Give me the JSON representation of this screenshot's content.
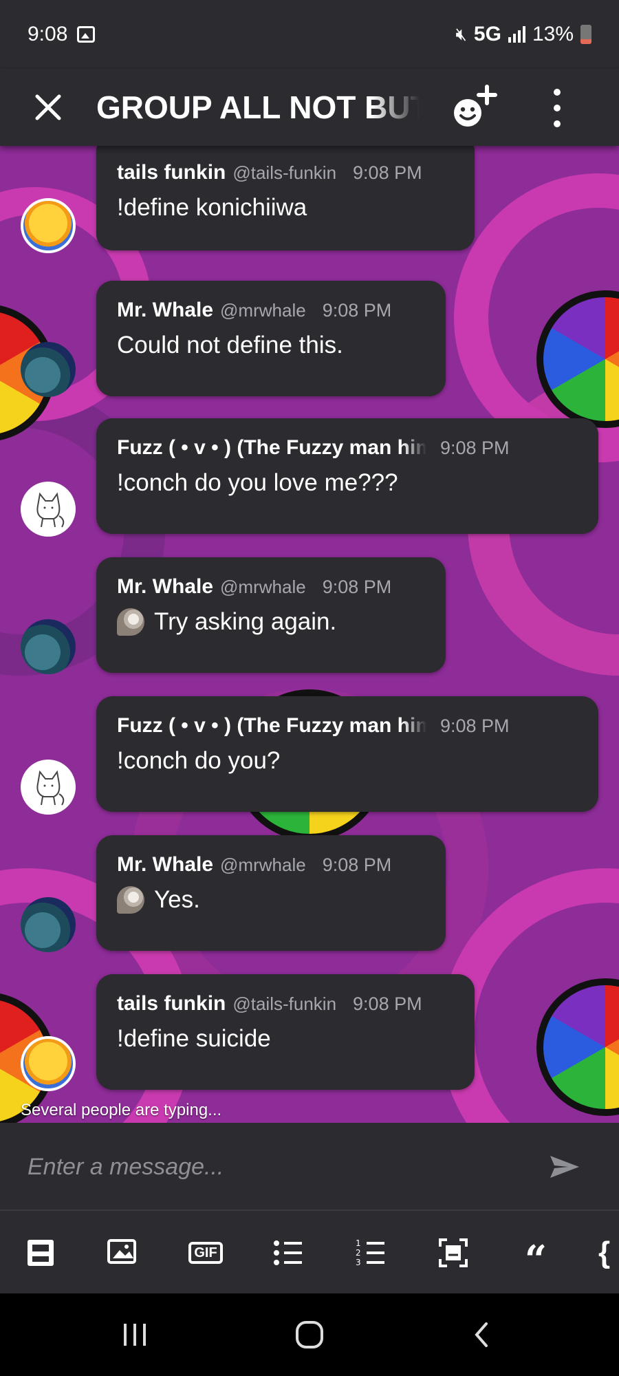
{
  "status_bar": {
    "time": "9:08",
    "network": "5G",
    "battery": "13%"
  },
  "header": {
    "title": "GROUP ALL NOT BUT"
  },
  "messages": [
    {
      "author": "tails funkin",
      "handle": "@tails-funkin",
      "time": "9:08 PM",
      "text": "!define konichiiwa",
      "avatar": "tails"
    },
    {
      "author": "Mr. Whale",
      "handle": "@mrwhale",
      "time": "9:08 PM",
      "text": "Could not define this.",
      "avatar": "whale"
    },
    {
      "author": "Fuzz ( • v • ) (The Fuzzy man himself)",
      "handle": "",
      "time": "9:08 PM",
      "text": "!conch do you love me???",
      "avatar": "cat"
    },
    {
      "author": "Mr. Whale",
      "handle": "@mrwhale",
      "time": "9:08 PM",
      "text": "Try asking again.",
      "avatar": "whale",
      "icon": "conch-shell-icon"
    },
    {
      "author": "Fuzz ( • v • ) (The Fuzzy man himself)",
      "handle": "",
      "time": "9:08 PM",
      "text": "!conch do you?",
      "avatar": "cat"
    },
    {
      "author": "Mr. Whale",
      "handle": "@mrwhale",
      "time": "9:08 PM",
      "text": "Yes.",
      "avatar": "whale",
      "icon": "conch-shell-icon"
    },
    {
      "author": "tails funkin",
      "handle": "@tails-funkin",
      "time": "9:08 PM",
      "text": "!define suicide",
      "avatar": "tails"
    }
  ],
  "typing_indicator": "Several people are typing...",
  "composer": {
    "placeholder": "Enter a message..."
  },
  "toolbar": {
    "gif_label": "GIF",
    "quote_label": "“",
    "code_label": "{",
    "icons": [
      "sticker-icon",
      "image-icon",
      "gif-icon",
      "bullet-list-icon",
      "numbered-list-icon",
      "spoiler-icon",
      "quote-icon",
      "code-block-icon"
    ]
  },
  "colors": {
    "bubble": "#2b2b30",
    "meta": "#a7a7b0",
    "background": "#8e2c98"
  }
}
